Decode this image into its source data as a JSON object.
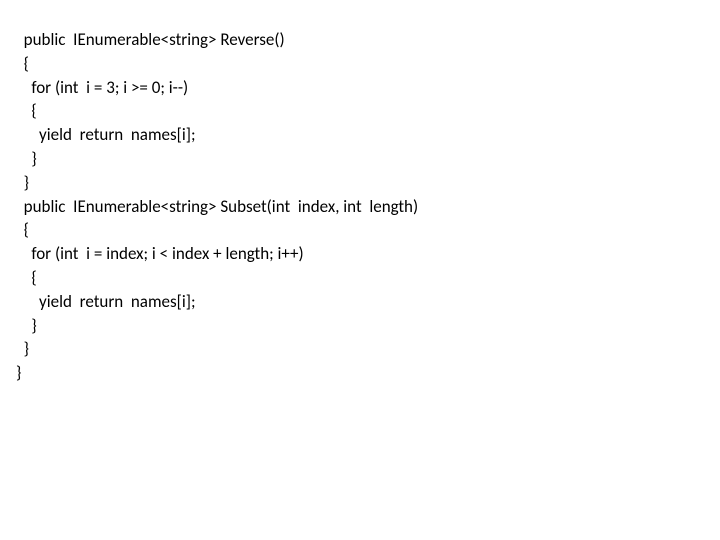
{
  "code": {
    "lines": [
      "  public  IEnumerable<string> Reverse()",
      "  {",
      "    for (int  i = 3; i >= 0; i--)",
      "    {",
      "      yield  return  names[i];",
      "    }",
      "  }",
      "  public  IEnumerable<string> Subset(int  index, int  length)",
      "  {",
      "    for (int  i = index; i < index + length; i++)",
      "    {",
      "      yield  return  names[i];",
      "    }",
      "  }",
      "}"
    ]
  }
}
